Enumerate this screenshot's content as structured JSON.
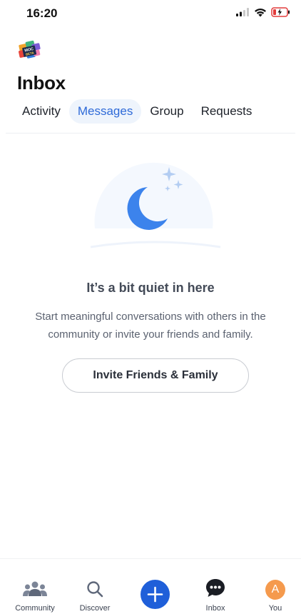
{
  "status_bar": {
    "time": "16:20"
  },
  "logo": {
    "lines": [
      "MOC",
      "BETA"
    ]
  },
  "header": {
    "title": "Inbox"
  },
  "tabs": [
    {
      "label": "Activity",
      "active": false
    },
    {
      "label": "Messages",
      "active": true
    },
    {
      "label": "Group",
      "active": false
    },
    {
      "label": "Requests",
      "active": false
    }
  ],
  "empty_state": {
    "title": "It’s a bit quiet in here",
    "message": "Start meaningful conversations with others in the community or invite your friends and family.",
    "button_label": "Invite Friends & Family",
    "icon": "moon-stars-icon"
  },
  "bottom_nav": {
    "items": [
      {
        "label": "Community",
        "icon": "community-icon"
      },
      {
        "label": "Discover",
        "icon": "search-icon"
      },
      {
        "label": "Inbox",
        "icon": "chat-bubble-icon"
      },
      {
        "label": "You",
        "icon": "avatar"
      }
    ],
    "compose_icon": "plus-icon",
    "avatar_initial": "A"
  },
  "colors": {
    "accent": "#1f5fd9",
    "tab_active_bg": "#eef4fc",
    "avatar": "#f59a4d",
    "moon": "#3c83ec"
  }
}
